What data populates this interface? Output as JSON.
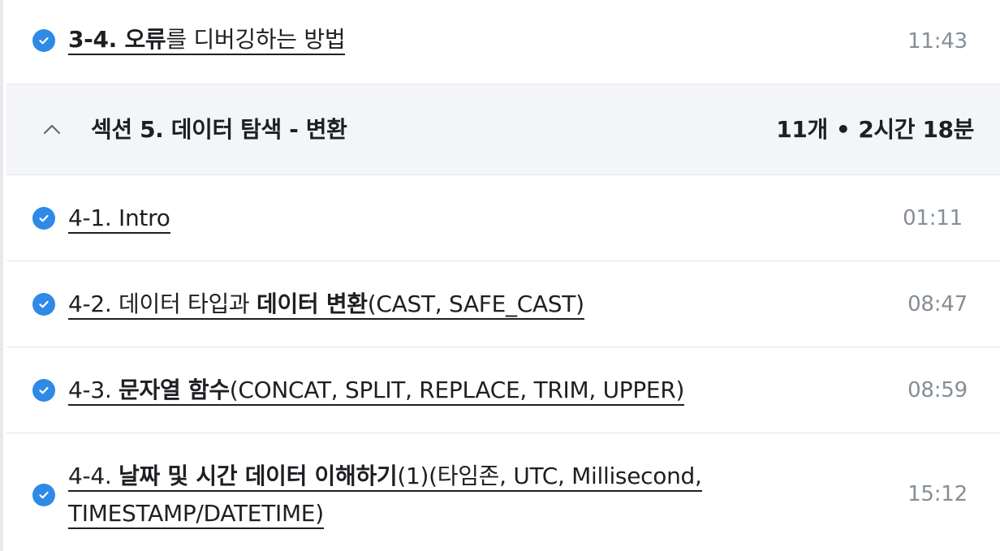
{
  "lectures_top": [
    {
      "title_bold": "3-4. 오류",
      "title_rest": "를 디버깅하는 방법",
      "time": "11:43"
    }
  ],
  "section": {
    "title": "섹션 5. 데이터 탐색 - 변환",
    "count": "11개",
    "separator": "•",
    "duration": "2시간 18분"
  },
  "lectures": [
    {
      "prefix": "4-1. Intro",
      "bold": "",
      "rest": "",
      "time": "01:11"
    },
    {
      "prefix": "4-2. 데이터 타입과 ",
      "bold": "데이터 변환",
      "rest": "(CAST, SAFE_CAST)",
      "time": "08:47"
    },
    {
      "prefix": "4-3. ",
      "bold": "문자열 함수",
      "rest": "(CONCAT, SPLIT, REPLACE, TRIM, UPPER)",
      "time": "08:59"
    },
    {
      "prefix": "4-4. ",
      "bold": "날짜 및 시간 데이터 이해하기",
      "rest": "(1)(타임존, UTC, Millisecond,",
      "line2": "TIMESTAMP/DATETIME)",
      "time": "15:12"
    }
  ],
  "icons": {
    "check": "check-circle-icon",
    "chevron": "chevron-up-icon"
  },
  "colors": {
    "check": "#2e8ae6",
    "section_bg": "#f4f5f7",
    "time": "#868e96"
  }
}
